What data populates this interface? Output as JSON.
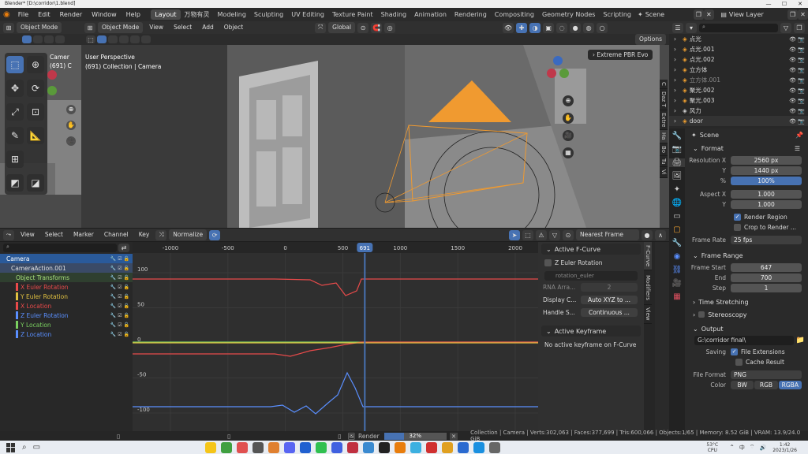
{
  "window": {
    "title": "Blender* [D:\\corridor\\1.blend]",
    "min": "—",
    "max": "☐",
    "close": "✕"
  },
  "menu": [
    "File",
    "Edit",
    "Render",
    "Window",
    "Help"
  ],
  "workspaces": [
    "Layout",
    "万物有灵",
    "Modeling",
    "Sculpting",
    "UV Editing",
    "Texture Paint",
    "Shading",
    "Animation",
    "Rendering",
    "Compositing",
    "Geometry Nodes",
    "Scripting"
  ],
  "scene": "Scene",
  "view_layer": "View Layer",
  "left_viewport": {
    "mode": "Object Mode",
    "camera_label": "Camer",
    "collection_label": "(691) C"
  },
  "viewport": {
    "mode": "Object Mode",
    "menus": [
      "View",
      "Select",
      "Add",
      "Object"
    ],
    "transform": "Global",
    "options": "Options",
    "info_line1": "User Perspective",
    "info_line2": "(691) Collection | Camera",
    "render_engine": "Extreme PBR Evo",
    "side_tabs": [
      "C",
      "Daz T",
      "Extre",
      "Ha",
      "Bo",
      "Tu",
      "Vi"
    ]
  },
  "graph_editor": {
    "menus": [
      "View",
      "Select",
      "Marker",
      "Channel",
      "Key"
    ],
    "normalize": "Normalize",
    "pivot": "Nearest Frame",
    "ruler": [
      "-1000",
      "-500",
      "0",
      "500",
      "1000",
      "1500",
      "2000"
    ],
    "current_frame": "691",
    "y_labels": [
      "100",
      "50",
      "0",
      "-50",
      "-100"
    ],
    "channels": [
      {
        "name": "Camera",
        "color": "#4a8fd8"
      },
      {
        "name": "CameraAction.001",
        "color": "#cfcfcf"
      },
      {
        "name": "Object Transforms",
        "color": "#a6e07a"
      },
      {
        "name": "X Euler Rotation",
        "color": "#e84a4a"
      },
      {
        "name": "Y Euler Rotation",
        "color": "#e0c040"
      },
      {
        "name": "X Location",
        "color": "#e84a4a"
      },
      {
        "name": "Z Euler Rotation",
        "color": "#5a8fff"
      },
      {
        "name": "Y Location",
        "color": "#7ad060"
      },
      {
        "name": "Z Location",
        "color": "#5a8fff"
      }
    ],
    "fcurve_panel": {
      "title": "Active F-Curve",
      "curve": "Z Euler Rotation",
      "path": "rotation_euler",
      "rna_label": "RNA Arra...",
      "rna_value": "2",
      "display_label": "Display C...",
      "display_value": "Auto XYZ to ...",
      "handle_label": "Handle S...",
      "handle_value": "Continuous ...",
      "keyframe_title": "Active Keyframe",
      "no_keyframe": "No active keyframe on F-Curve"
    },
    "tabs": [
      "F-Curve",
      "Modifiers",
      "View"
    ]
  },
  "outliner": {
    "search": "",
    "items": [
      {
        "name": "点光",
        "dim": false
      },
      {
        "name": "点光.001",
        "dim": false
      },
      {
        "name": "点光.002",
        "dim": false
      },
      {
        "name": "立方体",
        "dim": false
      },
      {
        "name": "立方体.001",
        "dim": true
      },
      {
        "name": "聚光.002",
        "dim": false
      },
      {
        "name": "聚光.003",
        "dim": false
      },
      {
        "name": "风力",
        "dim": false
      },
      {
        "name": "door",
        "dim": false
      }
    ]
  },
  "properties": {
    "scene_name": "Scene",
    "format": {
      "title": "Format",
      "res_x_label": "Resolution X",
      "res_x": "2560 px",
      "res_y_label": "Y",
      "res_y": "1440 px",
      "pct_label": "%",
      "pct": "100%",
      "aspect_x_label": "Aspect X",
      "aspect_x": "1.000",
      "aspect_y_label": "Y",
      "aspect_y": "1.000",
      "render_region": "Render Region",
      "crop": "Crop to Render ...",
      "frame_rate_label": "Frame Rate",
      "frame_rate": "25 fps"
    },
    "frame_range": {
      "title": "Frame Range",
      "start_label": "Frame Start",
      "start": "647",
      "end_label": "End",
      "end": "700",
      "step_label": "Step",
      "step": "1"
    },
    "time_stretching": "Time Stretching",
    "stereoscopy": "Stereoscopy",
    "output": {
      "title": "Output",
      "path": "G:\\corridor final\\",
      "saving_label": "Saving",
      "file_ext": "File Extensions",
      "cache": "Cache Result",
      "format_label": "File Format",
      "format": "PNG",
      "color_label": "Color",
      "colors": [
        "BW",
        "RGB",
        "RGBA"
      ]
    }
  },
  "status_bar": {
    "render_label": "Render",
    "progress": "32%",
    "progress_value": 0.32,
    "stats": "Collection | Camera | Verts:302,063 | Faces:377,699 | Tris:600,066 | Objects:1/65 | Memory: 8.52 GiB | VRAM: 13.9/24.0 GiB"
  },
  "taskbar": {
    "time": "1:42",
    "date": "2023/1/26",
    "weather": "53°C",
    "cpu": "CPU"
  }
}
